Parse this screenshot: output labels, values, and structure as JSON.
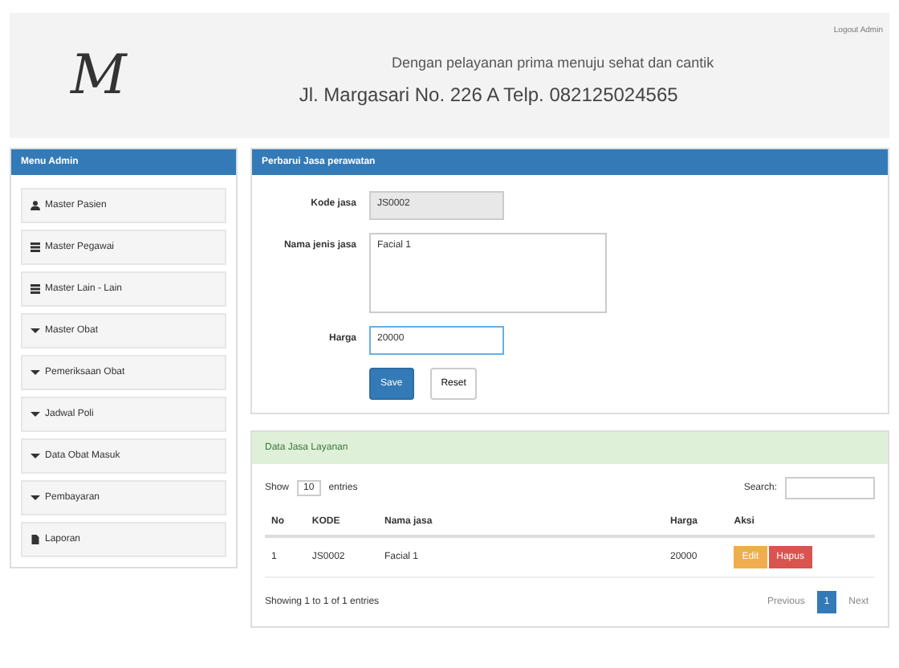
{
  "header": {
    "logo": "M",
    "user_link": "Logout Admin",
    "tagline": "Dengan pelayanan prima menuju sehat dan cantik",
    "address": "Jl. Margasari No. 226 A Telp. 082125024565"
  },
  "sidebar": {
    "title": "Menu Admin",
    "items": [
      {
        "label": "Master Pasien",
        "kind": "user"
      },
      {
        "label": "Master Pegawai",
        "kind": "list"
      },
      {
        "label": "Master Lain - Lain",
        "kind": "list"
      },
      {
        "label": "Master Obat",
        "kind": "caret"
      },
      {
        "label": "Pemeriksaan Obat",
        "kind": "caret"
      },
      {
        "label": "Jadwal Poli",
        "kind": "caret"
      },
      {
        "label": "Data Obat Masuk",
        "kind": "caret"
      },
      {
        "label": "Pembayaran",
        "kind": "caret"
      },
      {
        "label": "Laporan",
        "kind": "file"
      }
    ]
  },
  "form": {
    "title": "Perbarui Jasa perawatan",
    "fields": [
      {
        "label": "Kode jasa",
        "value": "JS0002",
        "kind": "readonly"
      },
      {
        "label": "Nama jenis jasa",
        "value": "Facial 1",
        "kind": "textarea"
      },
      {
        "label": "Harga",
        "value": "20000",
        "kind": "input"
      }
    ],
    "buttons": [
      {
        "label": "Save",
        "kind": "primary"
      },
      {
        "label": "Reset",
        "kind": "default"
      }
    ]
  },
  "table_panel": {
    "title": "Data Jasa Layanan",
    "length_prefix": "Show",
    "length_value": "10",
    "length_suffix": "entries",
    "search_label": "Search:",
    "columns": [
      "No",
      "KODE",
      "Nama jasa",
      "Harga",
      "Aksi"
    ],
    "rows": [
      {
        "cells": [
          "1",
          "JS0002",
          "Facial 1",
          "20000"
        ],
        "actions": [
          {
            "label": "Edit",
            "kind": "warning"
          },
          {
            "label": "Hapus",
            "kind": "danger"
          }
        ]
      }
    ],
    "info": "Showing 1 to 1 of 1 entries",
    "pagination": [
      {
        "label": "Previous",
        "selected": false
      },
      {
        "label": "1",
        "selected": true
      },
      {
        "label": "Next",
        "selected": false
      }
    ]
  }
}
